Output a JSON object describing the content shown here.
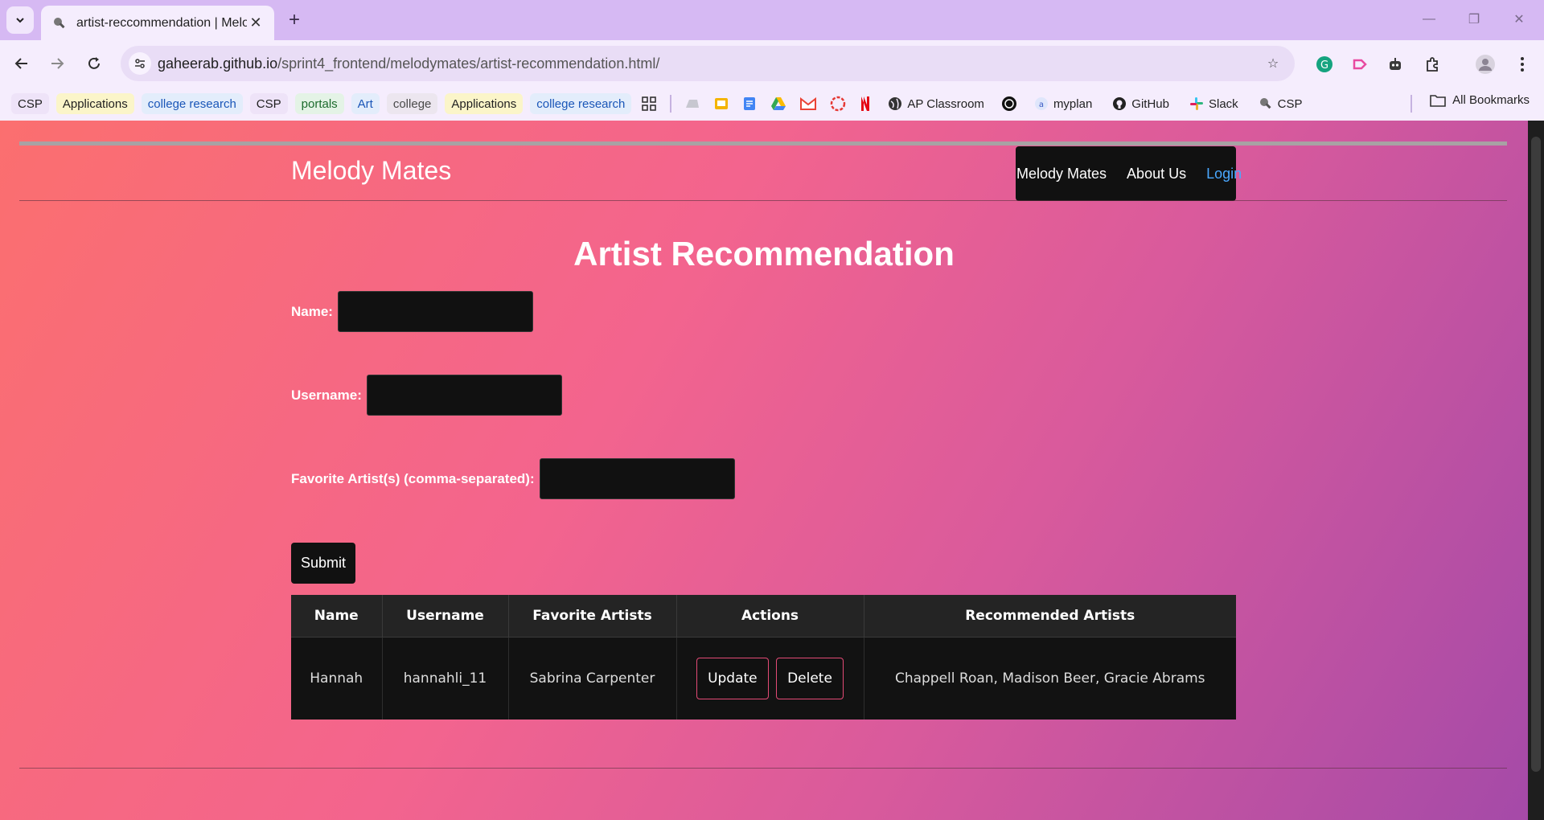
{
  "browser": {
    "tab_title": "artist-reccommendation | Melo",
    "url_host": "gaheerab.github.io",
    "url_path": "/sprint4_frontend/melodymates/artist-recommendation.html/",
    "bookmarks": [
      {
        "label": "CSP",
        "bg": "#eee3f8",
        "color": "#1f1f1f"
      },
      {
        "label": "Applications",
        "bg": "#fbf5c9",
        "color": "#1f1f1f"
      },
      {
        "label": "college research",
        "bg": "#e3edfb",
        "color": "#1a56b8"
      },
      {
        "label": "CSP",
        "bg": "#eee3f8",
        "color": "#1f1f1f"
      },
      {
        "label": "portals",
        "bg": "#e4f3e6",
        "color": "#1c6b2d"
      },
      {
        "label": "Art",
        "bg": "#e3edfb",
        "color": "#1a56b8"
      },
      {
        "label": "college",
        "bg": "#ece6ef",
        "color": "#4a4a4a"
      },
      {
        "label": "Applications",
        "bg": "#fbf5c9",
        "color": "#1f1f1f"
      },
      {
        "label": "college research",
        "bg": "#e3edfb",
        "color": "#1a56b8"
      }
    ],
    "icon_bookmarks": [
      "AP Classroom",
      "myplan",
      "GitHub",
      "Slack",
      "CSP"
    ],
    "all_bookmarks": "All Bookmarks"
  },
  "page": {
    "brand": "Melody Mates",
    "nav": [
      "Melody Mates",
      "About Us",
      "Login"
    ],
    "title": "Artist Recommendation",
    "form": {
      "name_label": "Name:",
      "username_label": "Username:",
      "artists_label": "Favorite Artist(s) (comma-separated):",
      "submit_label": "Submit"
    },
    "table": {
      "headers": [
        "Name",
        "Username",
        "Favorite Artists",
        "Actions",
        "Recommended Artists"
      ],
      "rows": [
        {
          "name": "Hannah",
          "username": "hannahli_11",
          "favorite_artists": "Sabrina Carpenter",
          "update_label": "Update",
          "delete_label": "Delete",
          "recommended": "Chappell Roan, Madison Beer, Gracie Abrams"
        }
      ]
    }
  }
}
